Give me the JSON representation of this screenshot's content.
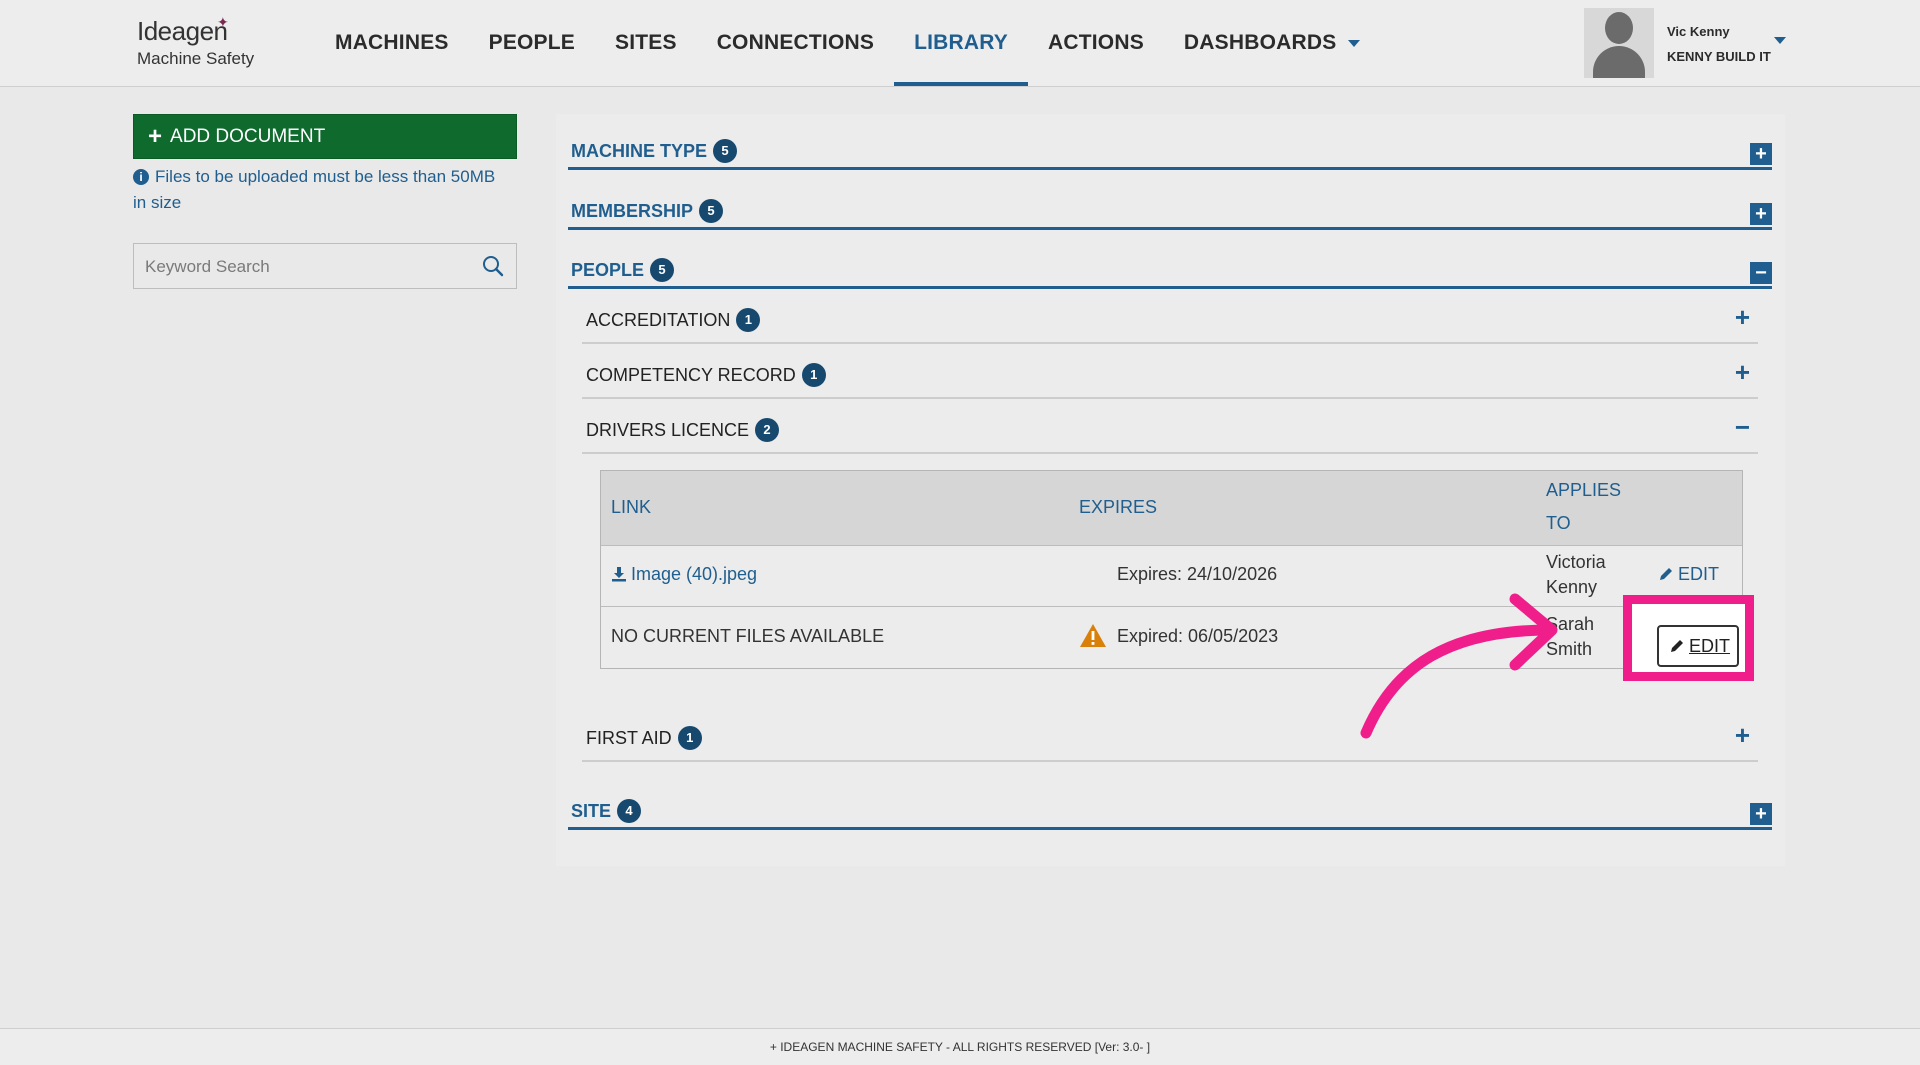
{
  "brand": {
    "name": "Ideagen",
    "product": "Machine Safety"
  },
  "nav": {
    "items": [
      {
        "label": "MACHINES"
      },
      {
        "label": "PEOPLE"
      },
      {
        "label": "SITES"
      },
      {
        "label": "CONNECTIONS"
      },
      {
        "label": "LIBRARY",
        "active": true
      },
      {
        "label": "ACTIONS"
      },
      {
        "label": "DASHBOARDS",
        "dropdown": true
      }
    ]
  },
  "user": {
    "name": "Vic Kenny",
    "org": "KENNY BUILD IT"
  },
  "sidebar": {
    "add_document": "ADD DOCUMENT",
    "upload_note": "Files to be uploaded must be less than 50MB in size",
    "search_placeholder": "Keyword Search"
  },
  "library": {
    "machine_type": {
      "label": "MACHINE TYPE",
      "count": "5",
      "toggle": "+"
    },
    "membership": {
      "label": "MEMBERSHIP",
      "count": "5",
      "toggle": "+"
    },
    "people": {
      "label": "PEOPLE",
      "count": "5",
      "toggle": "−",
      "accreditation": {
        "label": "ACCREDITATION",
        "count": "1",
        "toggle": "+"
      },
      "competency": {
        "label": "COMPETENCY RECORD",
        "count": "1",
        "toggle": "+"
      },
      "drivers": {
        "label": "DRIVERS LICENCE",
        "count": "2",
        "toggle": "−",
        "table": {
          "headers": {
            "link": "LINK",
            "expires": "EXPIRES",
            "applies_1": "APPLIES",
            "applies_2": "TO"
          },
          "rows": [
            {
              "link": "Image (40).jpeg",
              "expires": "Expires: 24/10/2026",
              "applies_1": "Victoria",
              "applies_2": "Kenny",
              "edit": "EDIT"
            },
            {
              "link": "NO CURRENT FILES AVAILABLE",
              "expires": "Expired: 06/05/2023",
              "applies_1": "Sarah",
              "applies_2": "Smith",
              "edit": "EDIT"
            }
          ]
        }
      },
      "first_aid": {
        "label": "FIRST AID",
        "count": "1",
        "toggle": "+"
      }
    },
    "site": {
      "label": "SITE",
      "count": "4",
      "toggle": "+"
    }
  },
  "footer": {
    "text": "+ IDEAGEN MACHINE SAFETY - ALL RIGHTS RESERVED   [Ver: 3.0- ]"
  },
  "colors": {
    "primary": "#1f5e8e",
    "add_button": "#0f6a2e",
    "highlight": "#f01e8a",
    "warning": "#d9800a"
  }
}
